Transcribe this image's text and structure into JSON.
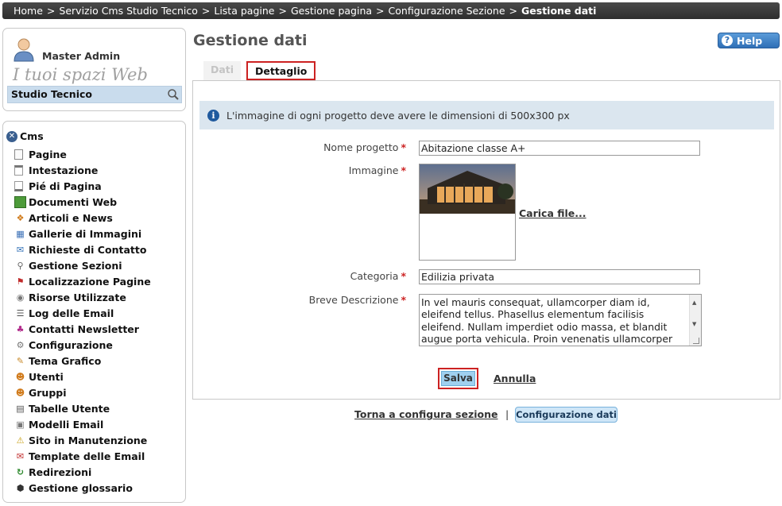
{
  "breadcrumb": [
    "Home",
    "Servizio Cms Studio Tecnico",
    "Lista pagine",
    "Gestione pagina",
    "Configurazione Sezione",
    "Gestione dati"
  ],
  "breadcrumb_sep": ">",
  "user": {
    "name": "Master Admin",
    "tagline": "I tuoi spazi Web",
    "site": "Studio Tecnico"
  },
  "menu": {
    "root": "Cms",
    "items": [
      {
        "label": "Pagine",
        "icon": "page-icon"
      },
      {
        "label": "Intestazione",
        "icon": "header-icon"
      },
      {
        "label": "Pié di Pagina",
        "icon": "footer-icon"
      },
      {
        "label": "Documenti Web",
        "icon": "web-document-icon"
      },
      {
        "label": "Articoli e News",
        "icon": "news-icon"
      },
      {
        "label": "Gallerie di Immagini",
        "icon": "gallery-icon"
      },
      {
        "label": "Richieste di Contatto",
        "icon": "contact-request-icon"
      },
      {
        "label": "Gestione Sezioni",
        "icon": "sections-icon"
      },
      {
        "label": "Localizzazione Pagine",
        "icon": "localization-icon"
      },
      {
        "label": "Risorse Utilizzate",
        "icon": "resources-icon"
      },
      {
        "label": "Log delle Email",
        "icon": "email-log-icon"
      },
      {
        "label": "Contatti Newsletter",
        "icon": "newsletter-icon"
      },
      {
        "label": "Configurazione",
        "icon": "gear-icon"
      },
      {
        "label": "Tema Grafico",
        "icon": "palette-icon"
      },
      {
        "label": "Utenti",
        "icon": "user-icon"
      },
      {
        "label": "Gruppi",
        "icon": "group-icon"
      },
      {
        "label": "Tabelle Utente",
        "icon": "table-icon"
      },
      {
        "label": "Modelli Email",
        "icon": "email-template-icon"
      },
      {
        "label": "Sito in Manutenzione",
        "icon": "warning-icon"
      },
      {
        "label": "Template delle Email",
        "icon": "mail-icon"
      },
      {
        "label": "Redirezioni",
        "icon": "redirect-icon"
      },
      {
        "label": "Gestione glossario",
        "icon": "glossary-icon"
      }
    ]
  },
  "page": {
    "title": "Gestione dati",
    "help": "Help"
  },
  "tabs": {
    "dati": "Dati",
    "dettaglio": "Dettaglio"
  },
  "info": "L'immagine di ogni progetto deve avere le dimensioni di 500x300 px",
  "form": {
    "nome_label": "Nome progetto",
    "nome_value": "Abitazione classe A+",
    "immagine_label": "Immagine",
    "upload_label": "Carica file...",
    "categoria_label": "Categoria",
    "categoria_value": "Edilizia privata",
    "descrizione_label": "Breve Descrizione",
    "descrizione_value": "In vel mauris consequat, ullamcorper diam id, eleifend tellus. Phasellus elementum facilisis eleifend. Nullam imperdiet odio massa, et blandit augue porta vehicula. Proin venenatis ullamcorper enim, in vulputate nisi",
    "required_mark": "*"
  },
  "actions": {
    "save": "Salva",
    "cancel": "Annulla"
  },
  "footer": {
    "back": "Torna a configura sezione",
    "sep": "|",
    "config": "Configurazione dati"
  },
  "colors": {
    "accent": "#2f6fb6",
    "highlight": "#cc2222",
    "info_bg": "#dbe6ef"
  }
}
